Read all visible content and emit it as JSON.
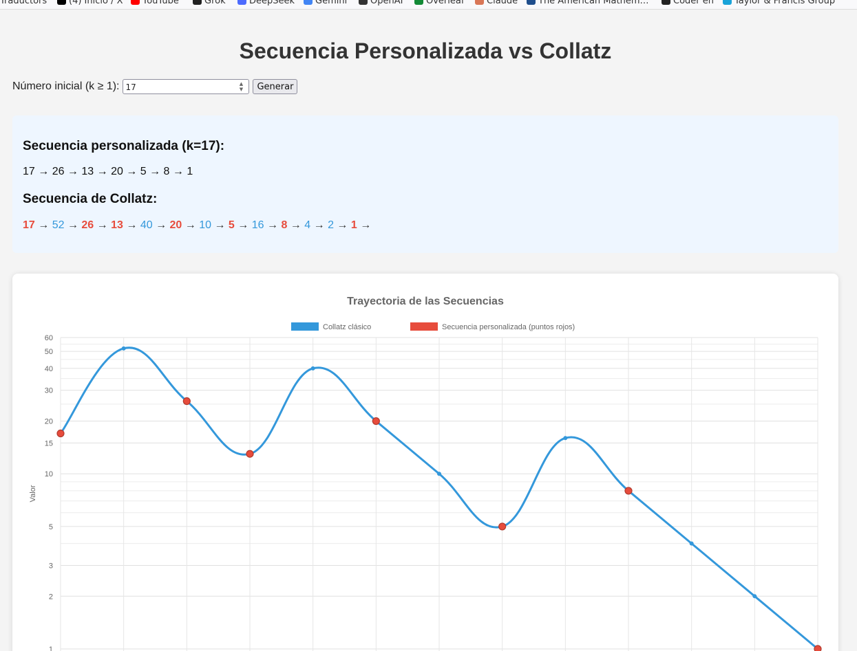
{
  "bookmarks": [
    {
      "label": "Traductors",
      "icon": "folder-icon",
      "color": "#888888"
    },
    {
      "label": "(4) Inicio / X",
      "icon": "x-icon",
      "color": "#000000"
    },
    {
      "label": "YouTube",
      "icon": "youtube-icon",
      "color": "#ff0000"
    },
    {
      "label": "Grok",
      "icon": "grok-icon",
      "color": "#222222"
    },
    {
      "label": "DeepSeek",
      "icon": "deepseek-icon",
      "color": "#4d6bfe"
    },
    {
      "label": "Gemini",
      "icon": "gemini-icon",
      "color": "#4285f4"
    },
    {
      "label": "OpenAI",
      "icon": "openai-icon",
      "color": "#333333"
    },
    {
      "label": "Overleaf",
      "icon": "overleaf-icon",
      "color": "#138a36"
    },
    {
      "label": "Claude",
      "icon": "claude-icon",
      "color": "#d97757"
    },
    {
      "label": "The American Mathem…",
      "icon": "ams-icon",
      "color": "#1f4e8c"
    },
    {
      "label": "Coder en",
      "icon": "coder-icon",
      "color": "#222222"
    },
    {
      "label": "Taylor & Francis Group",
      "icon": "taylor-francis-icon",
      "color": "#1aa3d9"
    }
  ],
  "page": {
    "title": "Secuencia Personalizada vs Collatz"
  },
  "controls": {
    "label": "Número inicial (k ≥ 1):",
    "value": "17",
    "button_label": "Generar"
  },
  "results": {
    "custom_heading": "Secuencia personalizada (k=17):",
    "custom_sequence": "17 → 26 → 13 → 20 → 5 → 8 → 1",
    "collatz_heading": "Secuencia de Collatz:",
    "collatz_terms": [
      "17",
      "52",
      "26",
      "13",
      "40",
      "20",
      "10",
      "5",
      "16",
      "8",
      "4",
      "2",
      "1"
    ],
    "collatz_highlighted": [
      true,
      false,
      true,
      true,
      false,
      true,
      false,
      true,
      false,
      true,
      false,
      false,
      true
    ],
    "arrow": "→"
  },
  "colors": {
    "collatz": "#3498db",
    "custom": "#e74c3c",
    "background": "#f4f4f4",
    "panel": "#eef6ff"
  },
  "chart_data": {
    "type": "line",
    "title": "Trayectoria de las Secuencias",
    "ylabel": "Valor",
    "yscale": "log",
    "ylim": [
      1,
      60
    ],
    "yticks": [
      1,
      2,
      3,
      5,
      10,
      15,
      20,
      30,
      40,
      50,
      60
    ],
    "grid": true,
    "legend": "top-center",
    "x": [
      0,
      1,
      2,
      3,
      4,
      5,
      6,
      7,
      8,
      9,
      10,
      11,
      12
    ],
    "series": [
      {
        "name": "Collatz clásico",
        "values": [
          17,
          52,
          26,
          13,
          40,
          20,
          10,
          5,
          16,
          8,
          4,
          2,
          1
        ]
      },
      {
        "name": "Secuencia personalizada (puntos rojos)",
        "x": [
          0,
          2,
          3,
          5,
          7,
          9,
          12
        ],
        "values": [
          17,
          26,
          13,
          20,
          5,
          8,
          1
        ]
      }
    ]
  }
}
